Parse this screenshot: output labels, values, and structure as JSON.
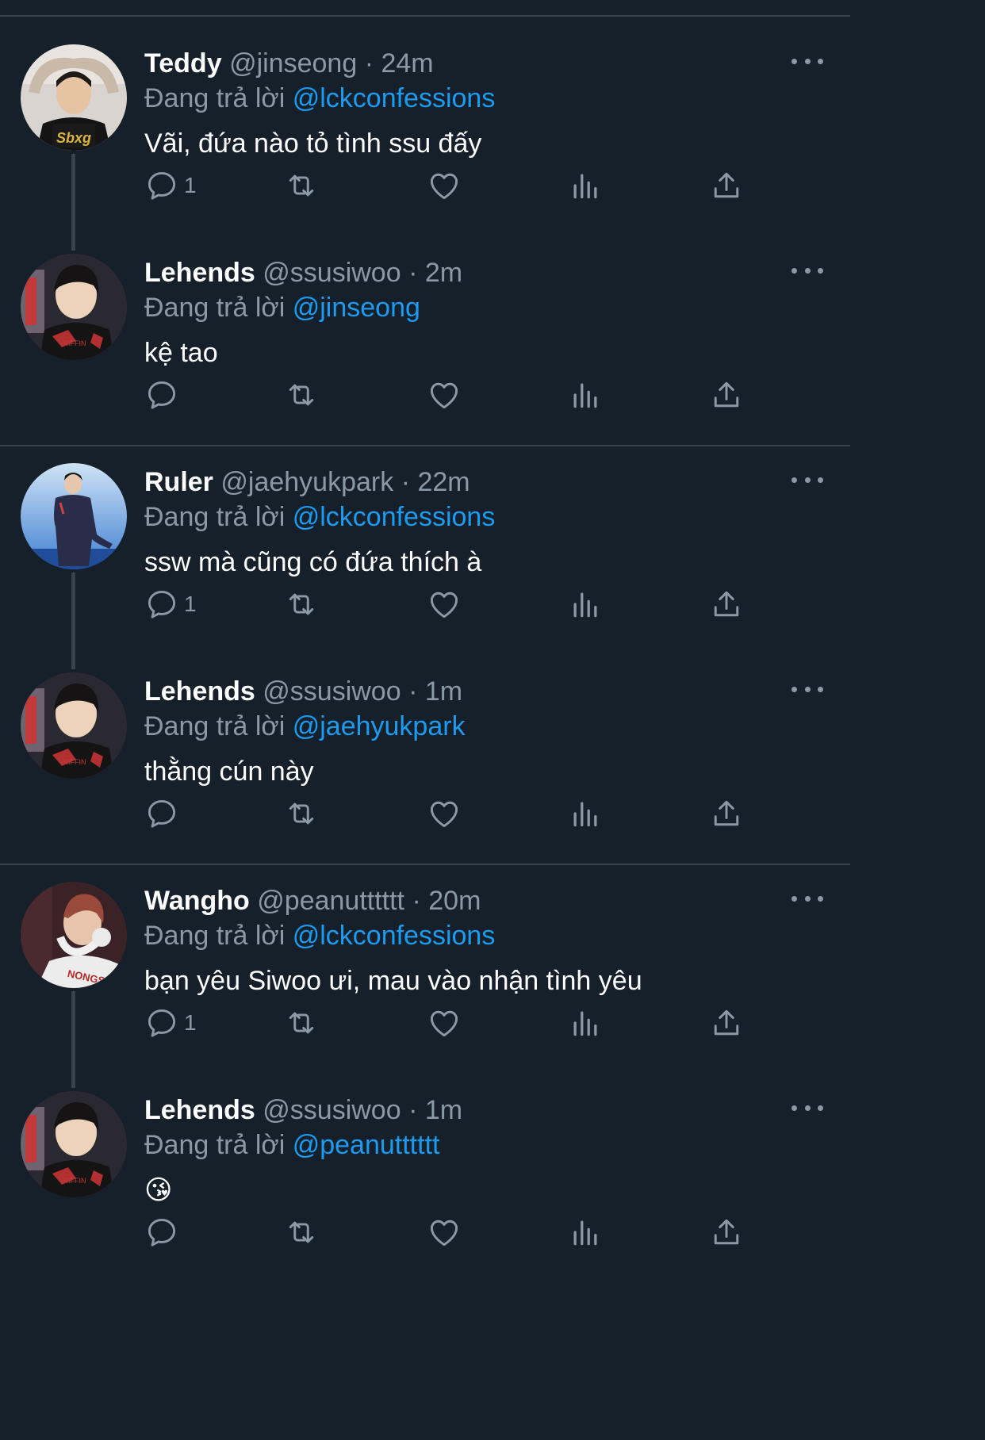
{
  "reply_prefix": "Đang trả lời",
  "colors": {
    "background": "#15202b",
    "divider": "#38444d",
    "muted": "#8b98a5",
    "mention": "#1d9bf0"
  },
  "threads": [
    {
      "parent": {
        "name": "Teddy",
        "handle": "@jinseong",
        "time": "24m",
        "reply_to": "@lckconfessions",
        "text": "Vãi, đứa nào tỏ tình ssu đấy",
        "reply_count": "1",
        "avatar_icon": "avatar-teddy"
      },
      "reply": {
        "name": "Lehends",
        "handle": "@ssusiwoo",
        "time": "2m",
        "reply_to": "@jinseong",
        "text": "kệ tao",
        "reply_count": "",
        "avatar_icon": "avatar-lehends"
      }
    },
    {
      "parent": {
        "name": "Ruler",
        "handle": "@jaehyukpark",
        "time": "22m",
        "reply_to": "@lckconfessions",
        "text": "ssw mà cũng có đứa thích à",
        "reply_count": "1",
        "avatar_icon": "avatar-ruler"
      },
      "reply": {
        "name": "Lehends",
        "handle": "@ssusiwoo",
        "time": "1m",
        "reply_to": "@jaehyukpark",
        "text": "thằng cún này",
        "reply_count": "",
        "avatar_icon": "avatar-lehends"
      }
    },
    {
      "parent": {
        "name": "Wangho",
        "handle": "@peanutttttt",
        "time": "20m",
        "reply_to": "@lckconfessions",
        "text": "bạn yêu Siwoo ưi, mau vào nhận tình yêu",
        "reply_count": "1",
        "avatar_icon": "avatar-wangho"
      },
      "reply": {
        "name": "Lehends",
        "handle": "@ssusiwoo",
        "time": "1m",
        "reply_to": "@peanutttttt",
        "text": "😘",
        "reply_count": "",
        "avatar_icon": "avatar-lehends"
      }
    }
  ]
}
